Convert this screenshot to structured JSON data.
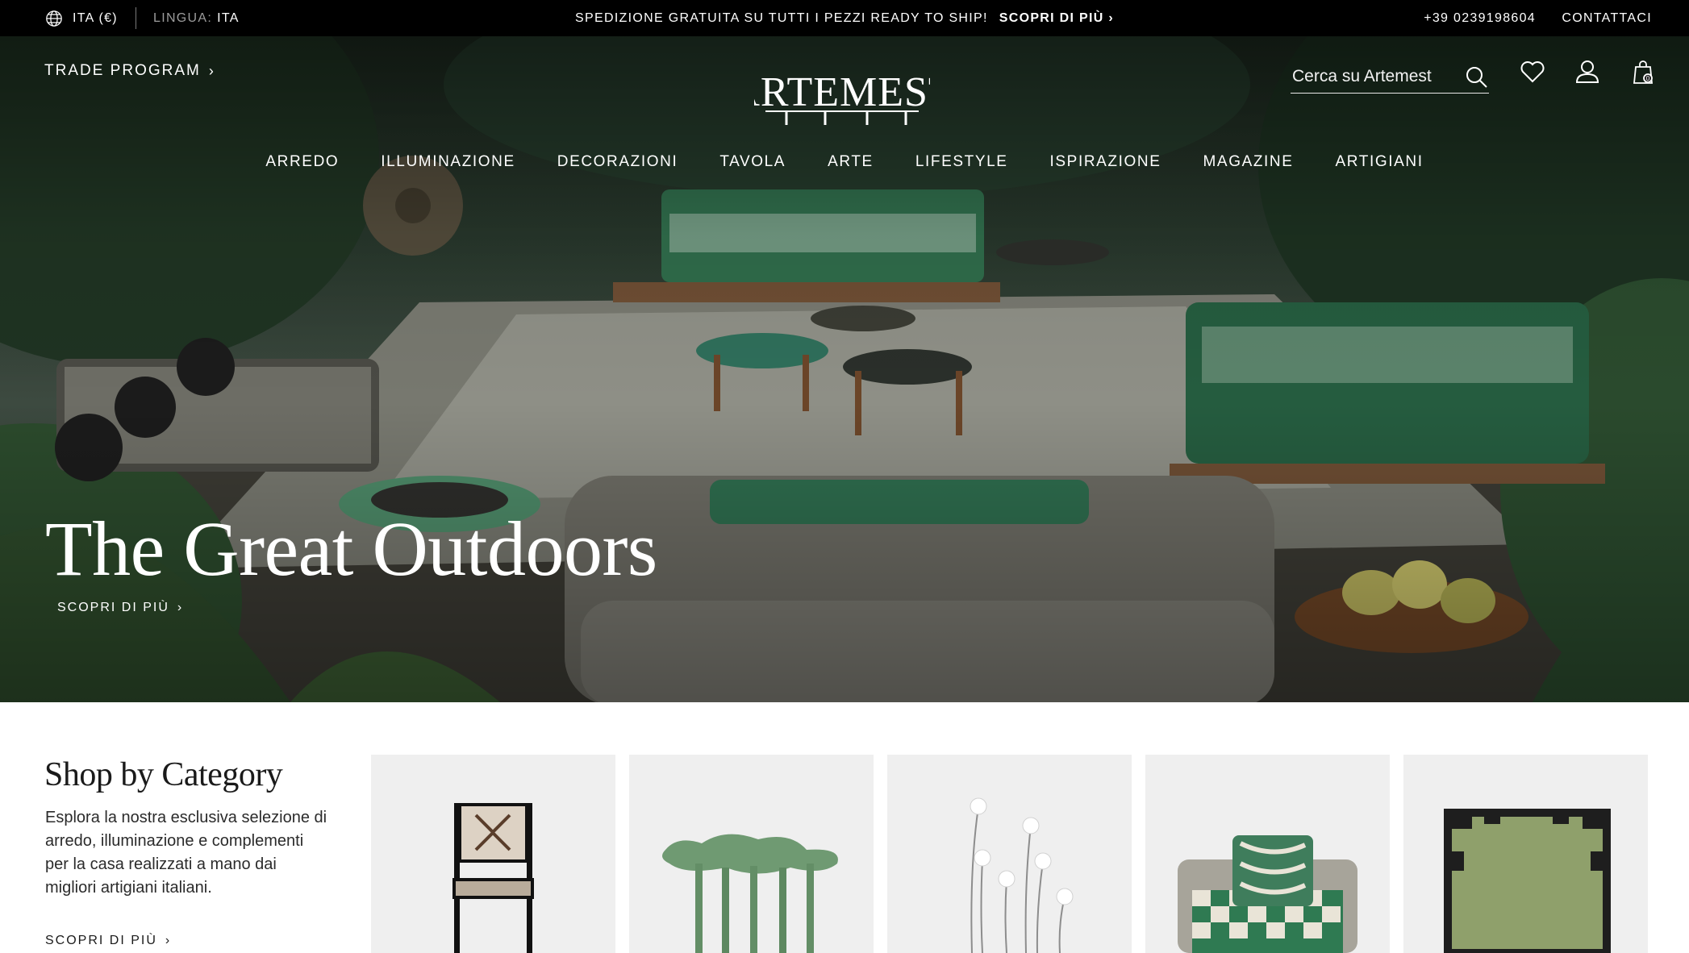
{
  "topbar": {
    "currency_label": "ITA (€)",
    "language_prefix": "LINGUA:",
    "language_value": "ITA",
    "promo_text": "SPEDIZIONE GRATUITA SU TUTTI I PEZZI READY TO SHIP!",
    "promo_link": "SCOPRI DI PIÙ",
    "phone": "+39 0239198604",
    "contact": "CONTATTACI"
  },
  "header": {
    "trade_program": "TRADE PROGRAM",
    "logo_text": "ARTEMEST",
    "search_placeholder": "Cerca su Artemest",
    "cart_count": "0"
  },
  "nav": {
    "items": [
      "ARREDO",
      "ILLUMINAZIONE",
      "DECORAZIONI",
      "TAVOLA",
      "ARTE",
      "LIFESTYLE",
      "ISPIRAZIONE",
      "MAGAZINE",
      "ARTIGIANI"
    ]
  },
  "hero": {
    "title": "The Great Outdoors",
    "cta": "SCOPRI DI PIÙ"
  },
  "shop_by_category": {
    "title": "Shop by Category",
    "description": "Esplora la nostra esclusiva selezione di arredo, illuminazione e complementi per la casa realizzati a mano dai migliori artigiani italiani.",
    "cta": "SCOPRI DI PIÙ",
    "cards": [
      {
        "icon": "chair-icon"
      },
      {
        "icon": "table-icon"
      },
      {
        "icon": "lamp-icon"
      },
      {
        "icon": "daybed-icon"
      },
      {
        "icon": "rug-icon"
      }
    ]
  },
  "colors": {
    "topbar_bg": "#000000",
    "text_light": "#ffffff",
    "card_bg": "#efefef",
    "accent_green": "#5f8f63"
  }
}
